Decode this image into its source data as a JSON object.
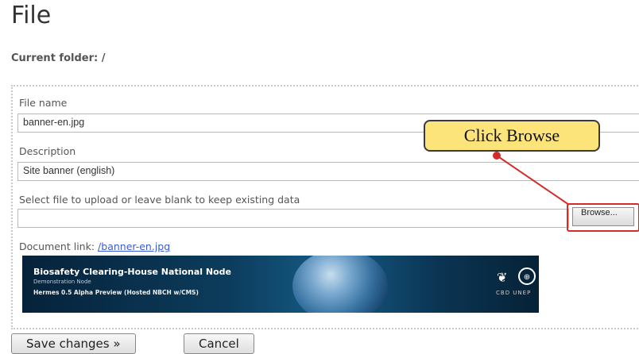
{
  "page": {
    "title": "File",
    "current_folder": "Current folder: /"
  },
  "form": {
    "file_name_label": "File name",
    "file_name_value": "banner-en.jpg",
    "description_label": "Description",
    "description_value": "Site banner (english)",
    "upload_label": "Select file to upload or leave blank to keep existing data",
    "upload_value": "",
    "browse_label": "Browse...",
    "document_link_label": "Document link:",
    "document_link_value": "/banner-en.jpg"
  },
  "annotation": {
    "callout_text": "Click Browse",
    "callout_color": "#fde47a",
    "highlight_color": "#d42b2b"
  },
  "banner": {
    "title": "Biosafety Clearing-House National Node",
    "subtitle": "Demonstration Node",
    "tagline": "Hermes 0.5 Alpha Preview (Hosted NBCH w/CMS)",
    "orgs": "CBD  UNEP",
    "icons": [
      "plant-icon",
      "un-emblem-icon",
      "globe-icon"
    ]
  },
  "actions": {
    "save_label": "Save changes »",
    "cancel_label": "Cancel"
  }
}
